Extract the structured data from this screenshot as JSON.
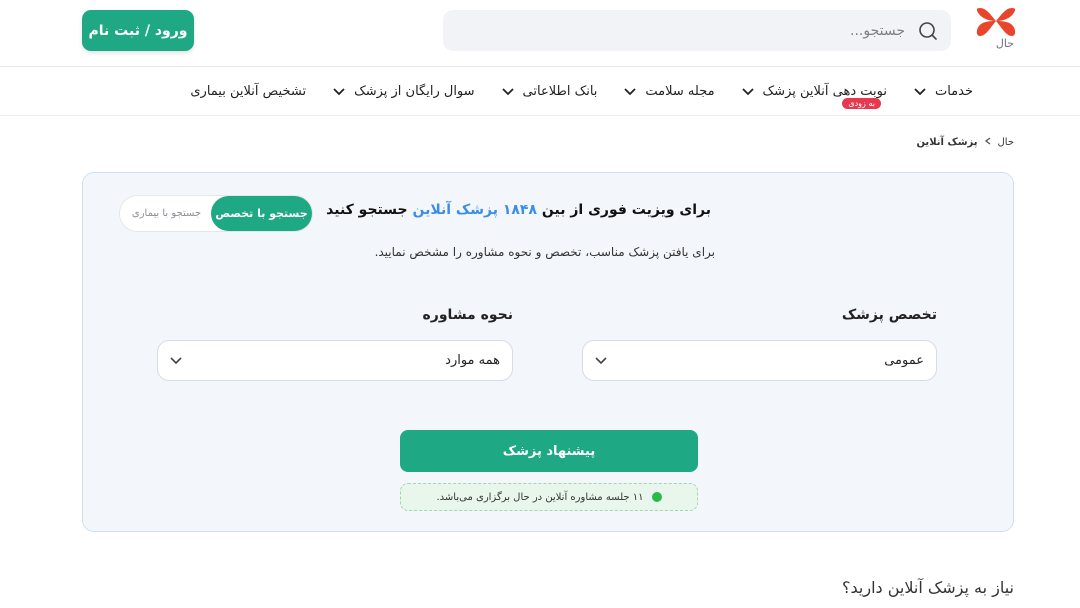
{
  "header": {
    "logo_text": "حال",
    "search_placeholder": "جستجو...",
    "login_label": "ورود / ثبت نام"
  },
  "nav": {
    "items": [
      {
        "label": "خدمات",
        "icon": "chevron-down-icon"
      },
      {
        "label": "نوبت دهی آنلاین پزشک",
        "icon": "chevron-down-icon",
        "badge": "به زودی"
      },
      {
        "label": "مجله سلامت",
        "icon": "chevron-down-icon"
      },
      {
        "label": "بانک اطلاعاتی",
        "icon": "chevron-down-icon"
      },
      {
        "label": "سوال رایگان از پزشک",
        "icon": "chevron-down-icon"
      },
      {
        "label": "تشخیص آنلاین بیماری"
      }
    ]
  },
  "breadcrumb": {
    "home": "حال",
    "current": "پزشک آنلاین"
  },
  "card": {
    "title_prefix": "برای ویزیت فوری از بین",
    "title_accent": "۱۸۴۸ پزشک آنلاین",
    "title_suffix": "جستجو کنید",
    "subtitle": "برای یافتن پزشک مناسب، تخصص و نحوه مشاوره را مشخص نمایید.",
    "toggle": {
      "active": "جستجو با تخصص",
      "inactive": "جستجو با بیماری"
    },
    "specialty": {
      "label": "تخصص پزشک",
      "value": "عمومی"
    },
    "consult": {
      "label": "نحوه مشاوره",
      "value": "همه موارد"
    },
    "submit_label": "پیشنهاد پزشک",
    "status_text": "۱۱ جلسه مشاوره آنلاین در حال برگزاری می‌باشد."
  },
  "section": {
    "heading": "نیاز به پزشک آنلاین دارید؟"
  },
  "colors": {
    "primary": "#1fa884",
    "accent": "#3b8ee6",
    "card_bg": "#f3f7fc",
    "badge": "#e63950",
    "status_dot": "#2cb84b"
  }
}
